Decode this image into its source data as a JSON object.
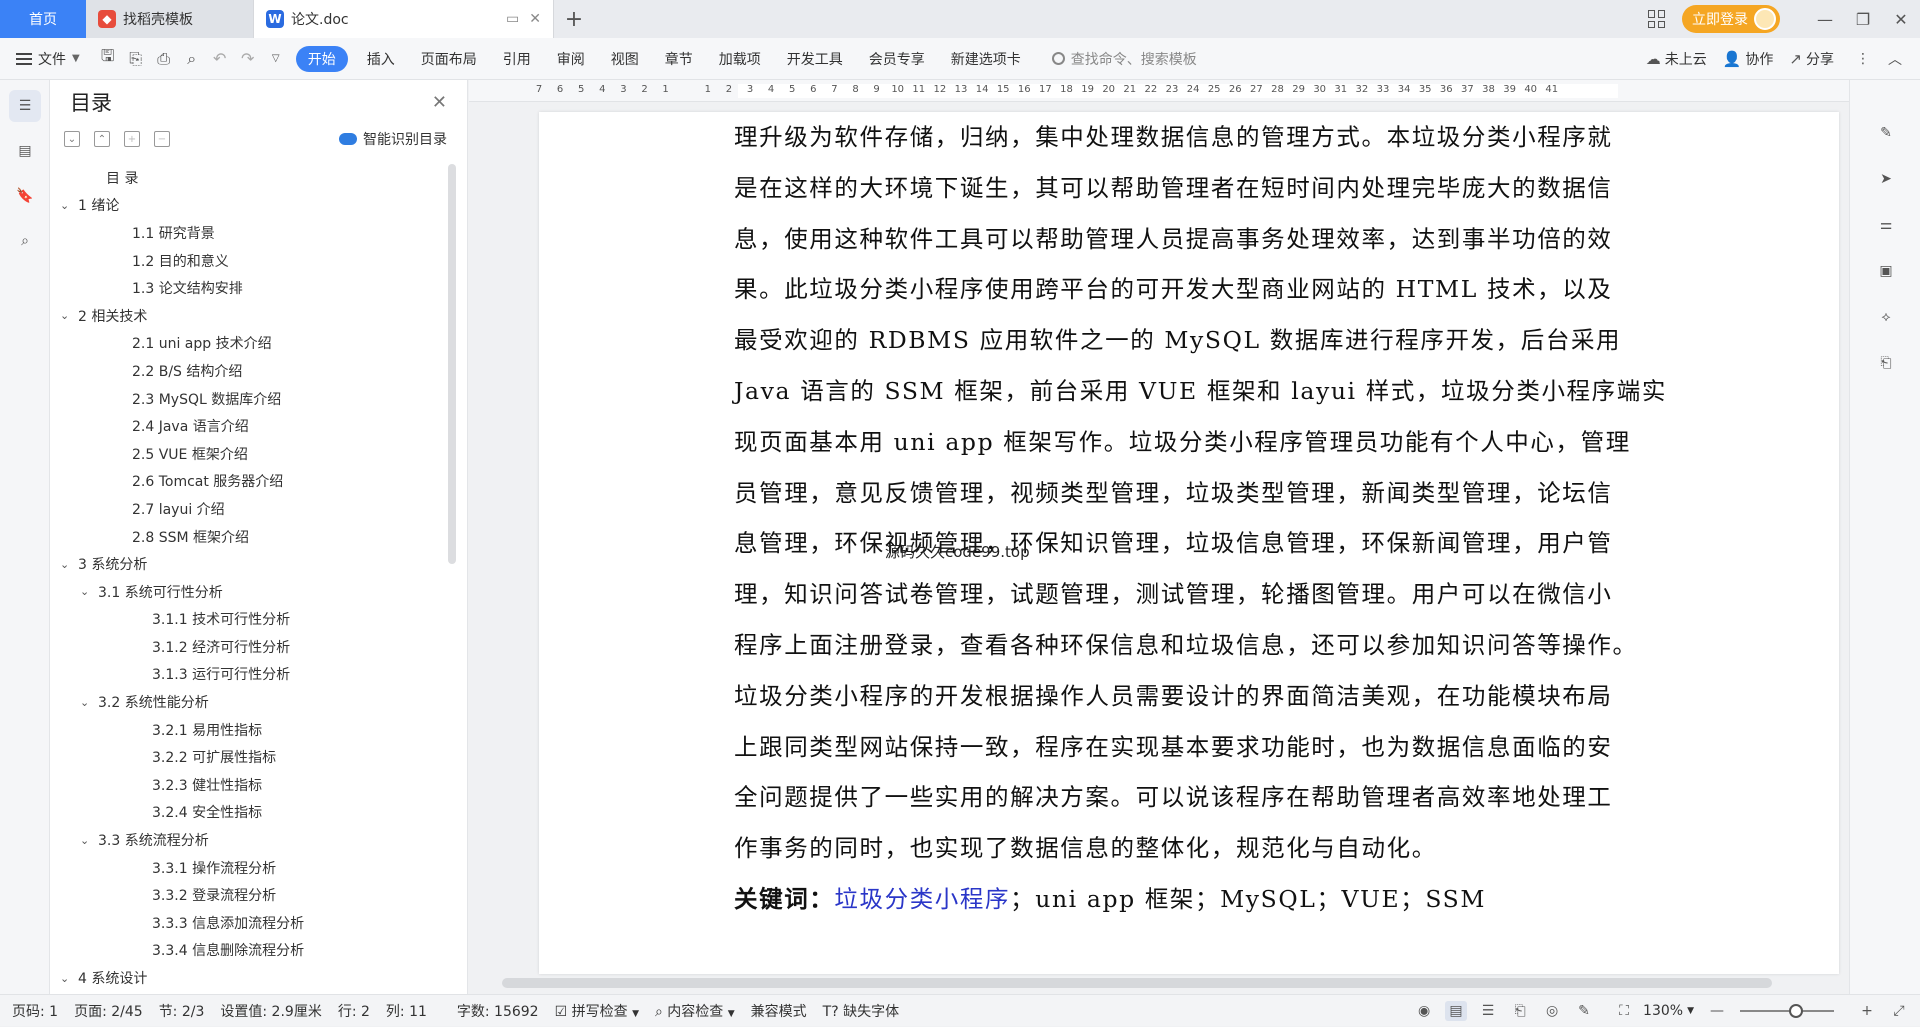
{
  "titlebar": {
    "home_tab": "首页",
    "tabs": [
      {
        "label": "找稻壳模板",
        "logo": "稻壳",
        "state": "inactive"
      },
      {
        "label": "论文.doc",
        "logo": "W",
        "state": "active"
      }
    ],
    "login_button": "立即登录"
  },
  "ribbon": {
    "file_menu": "文件",
    "tabs": [
      "开始",
      "插入",
      "页面布局",
      "引用",
      "审阅",
      "视图",
      "章节",
      "加载项",
      "开发工具",
      "会员专享",
      "新建选项卡"
    ],
    "active_tab": "开始",
    "search_placeholder": "查找命令、搜索模板",
    "right": {
      "cloud": "未上云",
      "collab": "协作",
      "share": "分享"
    }
  },
  "toc": {
    "title": "目录",
    "smart_button": "智能识别目录",
    "items": [
      {
        "label": "目  录",
        "level": 1,
        "chevron": false
      },
      {
        "label": "1  绪论",
        "level": 0,
        "chevron": true
      },
      {
        "label": "1.1  研究背景",
        "level": 2,
        "chevron": false
      },
      {
        "label": "1.2  目的和意义",
        "level": 2,
        "chevron": false
      },
      {
        "label": "1.3  论文结构安排",
        "level": 2,
        "chevron": false
      },
      {
        "label": "2  相关技术",
        "level": 0,
        "chevron": true
      },
      {
        "label": "2.1 uni app 技术介绍",
        "level": 2,
        "chevron": false
      },
      {
        "label": "2.2 B/S 结构介绍",
        "level": 2,
        "chevron": false
      },
      {
        "label": "2.3 MySQL 数据库介绍",
        "level": 2,
        "chevron": false
      },
      {
        "label": "2.4 Java 语言介绍",
        "level": 2,
        "chevron": false
      },
      {
        "label": "2.5 VUE 框架介绍",
        "level": 2,
        "chevron": false
      },
      {
        "label": "2.6 Tomcat 服务器介绍",
        "level": 2,
        "chevron": false
      },
      {
        "label": "2.7 layui 介绍",
        "level": 2,
        "chevron": false
      },
      {
        "label": "2.8 SSM 框架介绍",
        "level": 2,
        "chevron": false
      },
      {
        "label": "3  系统分析",
        "level": 0,
        "chevron": true
      },
      {
        "label": "3.1  系统可行性分析",
        "level": 1,
        "chevron": true
      },
      {
        "label": "3.1.1  技术可行性分析",
        "level": 3,
        "chevron": false
      },
      {
        "label": "3.1.2  经济可行性分析",
        "level": 3,
        "chevron": false
      },
      {
        "label": "3.1.3  运行可行性分析",
        "level": 3,
        "chevron": false
      },
      {
        "label": "3.2  系统性能分析",
        "level": 1,
        "chevron": true
      },
      {
        "label": "3.2.1  易用性指标",
        "level": 3,
        "chevron": false
      },
      {
        "label": "3.2.2  可扩展性指标",
        "level": 3,
        "chevron": false
      },
      {
        "label": "3.2.3  健壮性指标",
        "level": 3,
        "chevron": false
      },
      {
        "label": "3.2.4  安全性指标",
        "level": 3,
        "chevron": false
      },
      {
        "label": "3.3  系统流程分析",
        "level": 1,
        "chevron": true
      },
      {
        "label": "3.3.1  操作流程分析",
        "level": 3,
        "chevron": false
      },
      {
        "label": "3.3.2  登录流程分析",
        "level": 3,
        "chevron": false
      },
      {
        "label": "3.3.3  信息添加流程分析",
        "level": 3,
        "chevron": false
      },
      {
        "label": "3.3.4  信息删除流程分析",
        "level": 3,
        "chevron": false
      },
      {
        "label": "4  系统设计",
        "level": 0,
        "chevron": true
      }
    ]
  },
  "ruler": {
    "numbers": [
      "7",
      "6",
      "5",
      "4",
      "3",
      "2",
      "1",
      "",
      "1",
      "2",
      "3",
      "4",
      "5",
      "6",
      "7",
      "8",
      "9",
      "10",
      "11",
      "12",
      "13",
      "14",
      "15",
      "16",
      "17",
      "18",
      "19",
      "20",
      "21",
      "22",
      "23",
      "24",
      "25",
      "26",
      "27",
      "28",
      "29",
      "30",
      "31",
      "32",
      "33",
      "34",
      "35",
      "36",
      "37",
      "38",
      "39",
      "40",
      "41"
    ]
  },
  "document": {
    "lines": [
      "理升级为软件存储，归纳，集中处理数据信息的管理方式。本垃圾分类小程序就",
      "是在这样的大环境下诞生，其可以帮助管理者在短时间内处理完毕庞大的数据信",
      "息，使用这种软件工具可以帮助管理人员提高事务处理效率，达到事半功倍的效",
      "果。此垃圾分类小程序使用跨平台的可开发大型商业网站的 HTML 技术，以及",
      "最受欢迎的 RDBMS 应用软件之一的 MySQL 数据库进行程序开发，后台采用",
      "Java 语言的 SSM 框架，前台采用 VUE 框架和 layui 样式，垃圾分类小程序端实",
      "现页面基本用 uni app 框架写作。垃圾分类小程序管理员功能有个人中心，管理",
      "员管理，意见反馈管理，视频类型管理，垃圾类型管理，新闻类型管理，论坛信",
      "息管理，环保视频管理，环保知识管理，垃圾信息管理，环保新闻管理，用户管",
      "理，知识问答试卷管理，试题管理，测试管理，轮播图管理。用户可以在微信小",
      "程序上面注册登录，查看各种环保信息和垃圾信息，还可以参加知识问答等操作。",
      "垃圾分类小程序的开发根据操作人员需要设计的界面简洁美观，在功能模块布局",
      "上跟同类型网站保持一致，程序在实现基本要求功能时，也为数据信息面临的安",
      "全问题提供了一些实用的解决方案。可以说该程序在帮助管理者高效率地处理工",
      "作事务的同时，也实现了数据信息的整体化，规范化与自动化。"
    ],
    "keywords_label": "关键词：",
    "keywords_link": "垃圾分类小程序",
    "keywords_rest": "；uni app 框架；MySQL；VUE；SSM",
    "watermark": "源码久久code99.top"
  },
  "statusbar": {
    "page_code": "页码: 1",
    "page": "页面: 2/45",
    "section": "节: 2/3",
    "setting": "设置值: 2.9厘米",
    "row": "行: 2",
    "col": "列: 11",
    "words": "字数: 15692",
    "spell": "拼写检查",
    "content_check": "内容检查",
    "compat": "兼容模式",
    "missing_font": "缺失字体",
    "zoom": "130%",
    "zoom_fraction": 0.6
  },
  "colors": {
    "accent": "#3b82f6",
    "login": "#f5a623",
    "keyword_link": "#2a36c8"
  }
}
